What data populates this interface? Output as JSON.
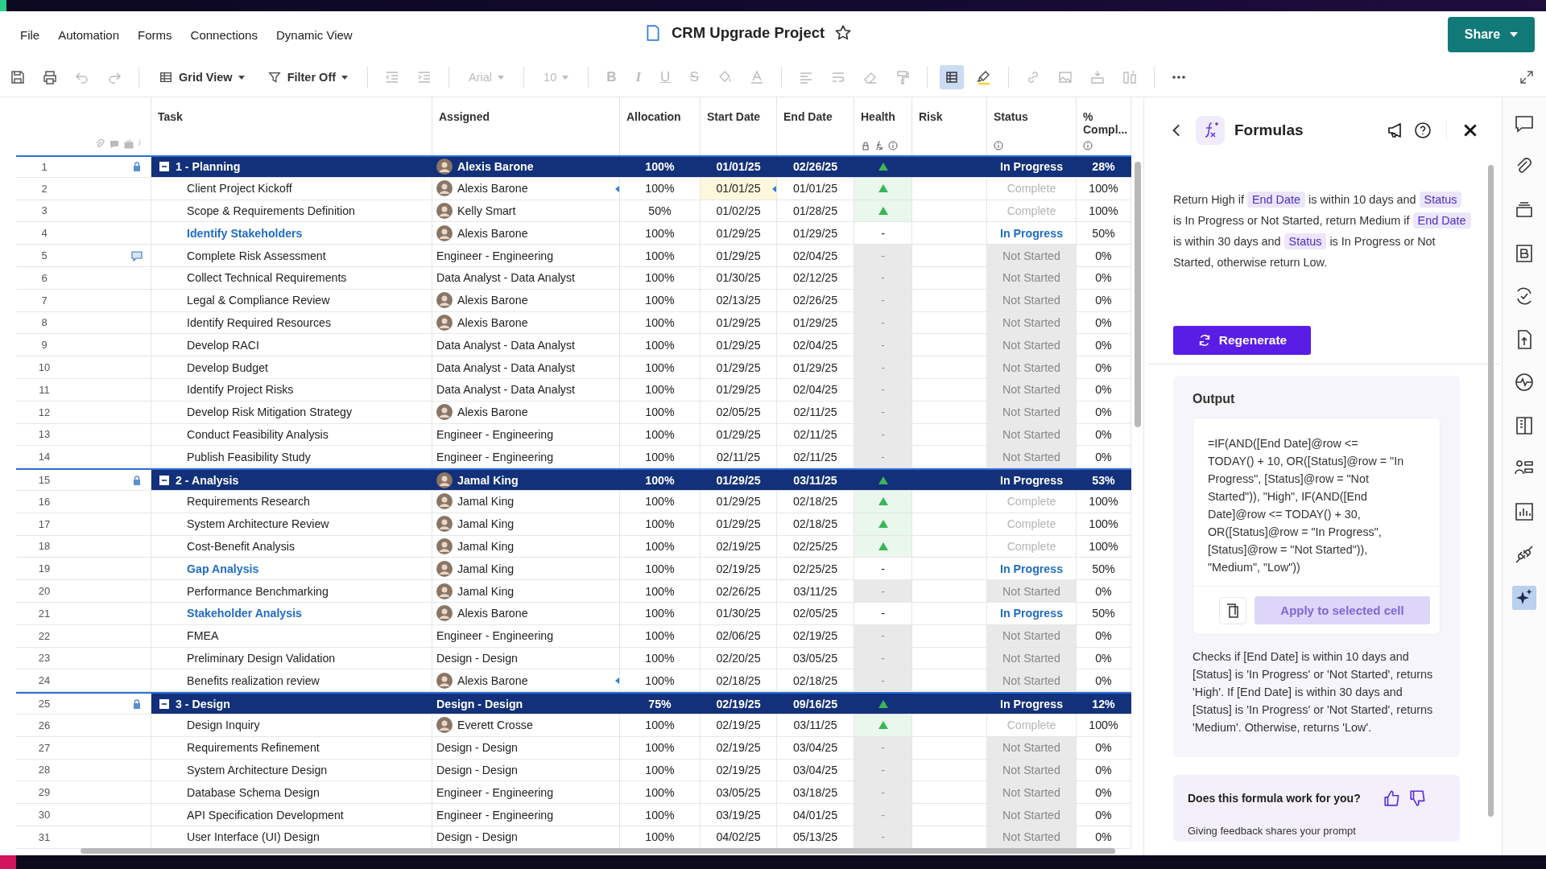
{
  "menu": [
    "File",
    "Automation",
    "Forms",
    "Connections",
    "Dynamic View"
  ],
  "title": "CRM Upgrade Project",
  "share_button": "Share",
  "toolbar": {
    "view_menu": "Grid View",
    "filter_menu": "Filter Off",
    "font_menu": {
      "label": "Arial",
      "disabled": true
    },
    "size_menu": {
      "label": "10",
      "disabled": true
    },
    "format_buttons": [
      {
        "label": "B",
        "disabled": true
      },
      {
        "label": "I",
        "disabled": true
      },
      {
        "label": "U",
        "disabled": true
      },
      {
        "label": "S",
        "disabled": true
      }
    ],
    "grid_toggle": {
      "selected": true
    }
  },
  "row_header_info": "i",
  "columns": [
    "Task",
    "Assigned",
    "Allocation",
    "Start Date",
    "End Date",
    "Health",
    "Risk",
    "Status",
    "% Compl..."
  ],
  "rows": [
    {
      "num": "1",
      "kind": "parent",
      "locked": true,
      "task": "1 - Planning",
      "assigned": "Alexis Barone",
      "avatar": true,
      "allocation": "100%",
      "start": "01/01/25",
      "end": "02/26/25",
      "health_up": true,
      "status": "In Progress",
      "started": true,
      "complete": false,
      "pct": "28%"
    },
    {
      "num": "2",
      "kind": "child",
      "task": "Client Project Kickoff",
      "assigned": "Alexis Barone",
      "avatar": true,
      "allocation": "100%",
      "start": "01/01/25",
      "end": "01/01/25",
      "health_up": true,
      "status": "Complete",
      "started": true,
      "complete": true,
      "pct": "100%",
      "predecessor_marker": true,
      "start_highlight": true
    },
    {
      "num": "3",
      "kind": "child",
      "task": "Scope & Requirements Definition",
      "assigned": "Kelly Smart",
      "avatar": true,
      "allocation": "50%",
      "start": "01/02/25",
      "end": "01/28/25",
      "health_up": true,
      "status": "Complete",
      "started": true,
      "complete": true,
      "pct": "100%"
    },
    {
      "num": "4",
      "kind": "child",
      "task": "Identify Stakeholders",
      "assigned": "Alexis Barone",
      "avatar": true,
      "allocation": "100%",
      "start": "01/29/25",
      "end": "01/29/25",
      "health_up": false,
      "health": "-",
      "status": "In Progress",
      "started": true,
      "complete": false,
      "pct": "50%"
    },
    {
      "num": "5",
      "kind": "child",
      "comment": true,
      "task": "Complete Risk Assessment",
      "assigned": "Engineer - Engineering",
      "avatar": false,
      "allocation": "100%",
      "start": "01/29/25",
      "end": "02/04/25",
      "health_up": false,
      "health": "-",
      "status": "Not Started",
      "started": false,
      "complete": false,
      "pct": "0%"
    },
    {
      "num": "6",
      "kind": "child",
      "task": "Collect Technical Requirements",
      "assigned": "Data Analyst - Data Analyst",
      "avatar": false,
      "allocation": "100%",
      "start": "01/30/25",
      "end": "02/12/25",
      "health_up": false,
      "health": "-",
      "status": "Not Started",
      "started": false,
      "complete": false,
      "pct": "0%"
    },
    {
      "num": "7",
      "kind": "child",
      "task": "Legal & Compliance Review",
      "assigned": "Alexis Barone",
      "avatar": true,
      "allocation": "100%",
      "start": "02/13/25",
      "end": "02/26/25",
      "health_up": false,
      "health": "-",
      "status": "Not Started",
      "started": false,
      "complete": false,
      "pct": "0%"
    },
    {
      "num": "8",
      "kind": "child",
      "task": "Identify Required Resources",
      "assigned": "Alexis Barone",
      "avatar": true,
      "allocation": "100%",
      "start": "01/29/25",
      "end": "01/29/25",
      "health_up": false,
      "health": "-",
      "status": "Not Started",
      "started": false,
      "complete": false,
      "pct": "0%"
    },
    {
      "num": "9",
      "kind": "child",
      "task": "Develop RACI",
      "assigned": "Data Analyst - Data Analyst",
      "avatar": false,
      "allocation": "100%",
      "start": "01/29/25",
      "end": "02/04/25",
      "health_up": false,
      "health": "-",
      "status": "Not Started",
      "started": false,
      "complete": false,
      "pct": "0%"
    },
    {
      "num": "10",
      "kind": "child",
      "task": "Develop Budget",
      "assigned": "Data Analyst - Data Analyst",
      "avatar": false,
      "allocation": "100%",
      "start": "01/29/25",
      "end": "01/29/25",
      "health_up": false,
      "health": "-",
      "status": "Not Started",
      "started": false,
      "complete": false,
      "pct": "0%"
    },
    {
      "num": "11",
      "kind": "child",
      "task": "Identify Project Risks",
      "assigned": "Data Analyst - Data Analyst",
      "avatar": false,
      "allocation": "100%",
      "start": "01/29/25",
      "end": "02/04/25",
      "health_up": false,
      "health": "-",
      "status": "Not Started",
      "started": false,
      "complete": false,
      "pct": "0%"
    },
    {
      "num": "12",
      "kind": "child",
      "task": "Develop Risk Mitigation Strategy",
      "assigned": "Alexis Barone",
      "avatar": true,
      "allocation": "100%",
      "start": "02/05/25",
      "end": "02/11/25",
      "health_up": false,
      "health": "-",
      "status": "Not Started",
      "started": false,
      "complete": false,
      "pct": "0%"
    },
    {
      "num": "13",
      "kind": "child",
      "task": "Conduct Feasibility Analysis",
      "assigned": "Engineer - Engineering",
      "avatar": false,
      "allocation": "100%",
      "start": "01/29/25",
      "end": "02/11/25",
      "health_up": false,
      "health": "-",
      "status": "Not Started",
      "started": false,
      "complete": false,
      "pct": "0%"
    },
    {
      "num": "14",
      "kind": "child",
      "task": "Publish Feasibility Study",
      "assigned": "Engineer - Engineering",
      "avatar": false,
      "allocation": "100%",
      "start": "02/11/25",
      "end": "02/11/25",
      "health_up": false,
      "health": "-",
      "status": "Not Started",
      "started": false,
      "complete": false,
      "pct": "0%"
    },
    {
      "num": "15",
      "kind": "parent",
      "locked": true,
      "task": "2 - Analysis",
      "assigned": "Jamal King",
      "avatar": true,
      "allocation": "100%",
      "start": "01/29/25",
      "end": "03/11/25",
      "health_up": true,
      "status": "In Progress",
      "started": true,
      "complete": false,
      "pct": "53%"
    },
    {
      "num": "16",
      "kind": "child",
      "task": "Requirements Research",
      "assigned": "Jamal King",
      "avatar": true,
      "allocation": "100%",
      "start": "01/29/25",
      "end": "02/18/25",
      "health_up": true,
      "status": "Complete",
      "started": true,
      "complete": true,
      "pct": "100%"
    },
    {
      "num": "17",
      "kind": "child",
      "task": "System Architecture Review",
      "assigned": "Jamal King",
      "avatar": true,
      "allocation": "100%",
      "start": "01/29/25",
      "end": "02/18/25",
      "health_up": true,
      "status": "Complete",
      "started": true,
      "complete": true,
      "pct": "100%"
    },
    {
      "num": "18",
      "kind": "child",
      "task": "Cost-Benefit Analysis",
      "assigned": "Jamal King",
      "avatar": true,
      "allocation": "100%",
      "start": "02/19/25",
      "end": "02/25/25",
      "health_up": true,
      "status": "Complete",
      "started": true,
      "complete": true,
      "pct": "100%"
    },
    {
      "num": "19",
      "kind": "child",
      "task": "Gap Analysis",
      "assigned": "Jamal King",
      "avatar": true,
      "allocation": "100%",
      "start": "02/19/25",
      "end": "02/25/25",
      "health_up": false,
      "health": "-",
      "status": "In Progress",
      "started": true,
      "complete": false,
      "pct": "50%"
    },
    {
      "num": "20",
      "kind": "child",
      "task": "Performance Benchmarking",
      "assigned": "Jamal King",
      "avatar": true,
      "allocation": "100%",
      "start": "02/26/25",
      "end": "03/11/25",
      "health_up": false,
      "health": "-",
      "status": "Not Started",
      "started": false,
      "complete": false,
      "pct": "0%"
    },
    {
      "num": "21",
      "kind": "child",
      "task": "Stakeholder Analysis",
      "assigned": "Alexis Barone",
      "avatar": true,
      "allocation": "100%",
      "start": "01/30/25",
      "end": "02/05/25",
      "health_up": false,
      "health": "-",
      "status": "In Progress",
      "started": true,
      "complete": false,
      "pct": "50%"
    },
    {
      "num": "22",
      "kind": "child",
      "task": "FMEA",
      "assigned": "Engineer - Engineering",
      "avatar": false,
      "allocation": "100%",
      "start": "02/06/25",
      "end": "02/19/25",
      "health_up": false,
      "health": "-",
      "status": "Not Started",
      "started": false,
      "complete": false,
      "pct": "0%"
    },
    {
      "num": "23",
      "kind": "child",
      "task": "Preliminary Design Validation",
      "assigned": "Design - Design",
      "avatar": false,
      "allocation": "100%",
      "start": "02/20/25",
      "end": "03/05/25",
      "health_up": false,
      "health": "-",
      "status": "Not Started",
      "started": false,
      "complete": false,
      "pct": "0%"
    },
    {
      "num": "24",
      "kind": "child",
      "task": "Benefits realization review",
      "assigned": "Alexis Barone",
      "avatar": true,
      "allocation": "100%",
      "start": "02/18/25",
      "end": "02/18/25",
      "health_up": false,
      "health": "-",
      "status": "Not Started",
      "started": false,
      "complete": false,
      "pct": "0%",
      "predecessor_marker": true
    },
    {
      "num": "25",
      "kind": "parent",
      "locked": true,
      "task": "3 - Design",
      "assigned": "Design - Design",
      "avatar": false,
      "allocation": "75%",
      "start": "02/19/25",
      "end": "09/16/25",
      "health_up": true,
      "status": "In Progress",
      "started": true,
      "complete": false,
      "pct": "12%"
    },
    {
      "num": "26",
      "kind": "child",
      "task": "Design Inquiry",
      "assigned": "Everett Crosse",
      "avatar": true,
      "allocation": "100%",
      "start": "02/19/25",
      "end": "03/11/25",
      "health_up": true,
      "status": "Complete",
      "started": true,
      "complete": true,
      "pct": "100%"
    },
    {
      "num": "27",
      "kind": "child",
      "task": "Requirements Refinement",
      "assigned": "Design - Design",
      "avatar": false,
      "allocation": "100%",
      "start": "02/19/25",
      "end": "03/04/25",
      "health_up": false,
      "health": "-",
      "status": "Not Started",
      "started": false,
      "complete": false,
      "pct": "0%"
    },
    {
      "num": "28",
      "kind": "child",
      "task": "System Architecture Design",
      "assigned": "Design - Design",
      "avatar": false,
      "allocation": "100%",
      "start": "02/19/25",
      "end": "03/04/25",
      "health_up": false,
      "health": "-",
      "status": "Not Started",
      "started": false,
      "complete": false,
      "pct": "0%"
    },
    {
      "num": "29",
      "kind": "child",
      "task": "Database Schema Design",
      "assigned": "Engineer - Engineering",
      "avatar": false,
      "allocation": "100%",
      "start": "03/05/25",
      "end": "03/18/25",
      "health_up": false,
      "health": "-",
      "status": "Not Started",
      "started": false,
      "complete": false,
      "pct": "0%"
    },
    {
      "num": "30",
      "kind": "child",
      "task": "API Specification Development",
      "assigned": "Engineer - Engineering",
      "avatar": false,
      "allocation": "100%",
      "start": "03/19/25",
      "end": "04/01/25",
      "health_up": false,
      "health": "-",
      "status": "Not Started",
      "started": false,
      "complete": false,
      "pct": "0%"
    },
    {
      "num": "31",
      "kind": "child",
      "task": "User Interface (UI) Design",
      "assigned": "Design - Design",
      "avatar": false,
      "allocation": "100%",
      "start": "04/02/25",
      "end": "05/13/25",
      "health_up": false,
      "health": "-",
      "status": "Not Started",
      "started": false,
      "complete": false,
      "pct": "0%"
    }
  ],
  "panel": {
    "title": "Formulas",
    "prompt": [
      {
        "text": "Return High if ",
        "chip": false
      },
      {
        "text": "End Date",
        "chip": true
      },
      {
        "text": " is within 10 days and ",
        "chip": false
      },
      {
        "text": "Status",
        "chip": true
      },
      {
        "text": " is In Progress or Not Started, return Medium if ",
        "chip": false
      },
      {
        "text": "End Date",
        "chip": true
      },
      {
        "text": " is within 30 days and ",
        "chip": false
      },
      {
        "text": "Status",
        "chip": true
      },
      {
        "text": " is In Progress or Not Started, otherwise return Low.",
        "chip": false
      }
    ],
    "regenerate_button": "Regenerate",
    "output_title": "Output",
    "formula": "=IF(AND([End Date]@row <= TODAY() + 10, OR([Status]@row = \"In Progress\", [Status]@row = \"Not Started\")), \"High\", IF(AND([End Date]@row <= TODAY() + 30, OR([Status]@row = \"In Progress\", [Status]@row = \"Not Started\")), \"Medium\", \"Low\"))",
    "apply_button": {
      "label": "Apply to selected cell",
      "disabled": true
    },
    "explanation": "Checks if [End Date] is within 10 days and [Status] is 'In Progress' or 'Not Started', returns 'High'. If [End Date] is within 30 days and [Status] is 'In Progress' or 'Not Started', returns 'Medium'. Otherwise, returns 'Low'.",
    "feedback_question": "Does this formula work for you?",
    "feedback_note": "Giving feedback shares your prompt"
  },
  "side_tools": [
    {
      "selected": false
    },
    {
      "selected": false
    },
    {
      "selected": false
    },
    {
      "selected": false
    },
    {
      "selected": false
    },
    {
      "selected": false
    },
    {
      "selected": false
    },
    {
      "selected": false
    },
    {
      "selected": false
    },
    {
      "selected": false
    },
    {
      "selected": false
    },
    {
      "selected": true
    }
  ]
}
